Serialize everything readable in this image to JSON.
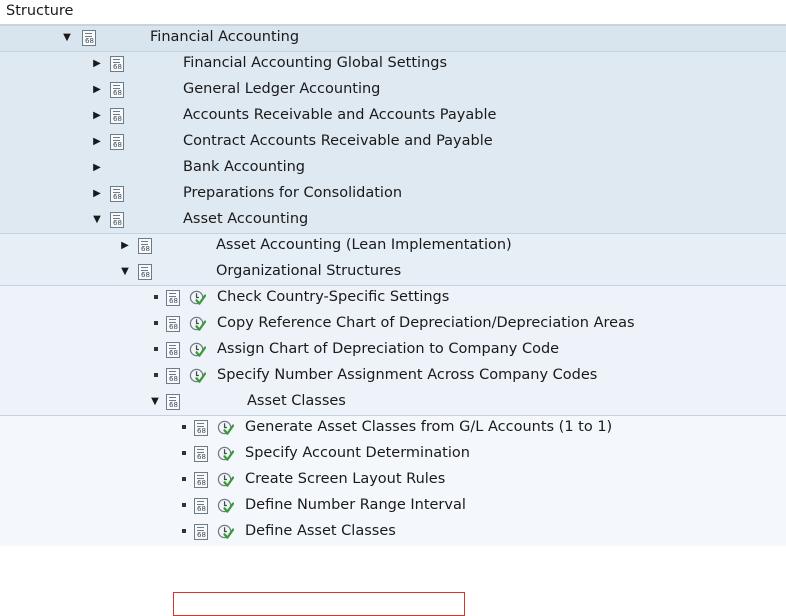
{
  "header": {
    "label": "Structure"
  },
  "rows": [
    {
      "label": "Financial Accounting",
      "toggle": "expanded",
      "icons": [
        "doc-icon"
      ]
    },
    {
      "label": "Financial Accounting Global Settings",
      "toggle": "collapsed",
      "icons": [
        "doc-icon"
      ]
    },
    {
      "label": "General Ledger Accounting",
      "toggle": "collapsed",
      "icons": [
        "doc-icon"
      ]
    },
    {
      "label": "Accounts Receivable and Accounts Payable",
      "toggle": "collapsed",
      "icons": [
        "doc-icon"
      ]
    },
    {
      "label": "Contract Accounts Receivable and Payable",
      "toggle": "collapsed",
      "icons": [
        "doc-icon"
      ]
    },
    {
      "label": "Bank Accounting",
      "toggle": "collapsed",
      "icons": []
    },
    {
      "label": "Preparations for Consolidation",
      "toggle": "collapsed",
      "icons": [
        "doc-icon"
      ]
    },
    {
      "label": "Asset Accounting",
      "toggle": "expanded",
      "icons": [
        "doc-icon"
      ]
    },
    {
      "label": "Asset Accounting (Lean Implementation)",
      "toggle": "collapsed",
      "icons": [
        "doc-icon"
      ]
    },
    {
      "label": "Organizational Structures",
      "toggle": "expanded",
      "icons": [
        "doc-icon"
      ]
    },
    {
      "label": "Check Country-Specific Settings",
      "toggle": "leaf",
      "icons": [
        "doc-icon",
        "execute-icon"
      ]
    },
    {
      "label": "Copy Reference Chart of Depreciation/Depreciation Areas",
      "toggle": "leaf",
      "icons": [
        "doc-icon",
        "execute-icon"
      ]
    },
    {
      "label": "Assign Chart of Depreciation to Company Code",
      "toggle": "leaf",
      "icons": [
        "doc-icon",
        "execute-icon"
      ]
    },
    {
      "label": "Specify Number Assignment Across Company Codes",
      "toggle": "leaf",
      "icons": [
        "doc-icon",
        "execute-icon"
      ]
    },
    {
      "label": "Asset Classes",
      "toggle": "expanded",
      "icons": [
        "doc-icon"
      ]
    },
    {
      "label": "Generate Asset Classes from G/L Accounts (1 to 1)",
      "toggle": "leaf",
      "icons": [
        "doc-icon",
        "execute-icon"
      ]
    },
    {
      "label": "Specify Account Determination",
      "toggle": "leaf",
      "icons": [
        "doc-icon",
        "execute-icon"
      ]
    },
    {
      "label": "Create Screen Layout Rules",
      "toggle": "leaf",
      "icons": [
        "doc-icon",
        "execute-icon"
      ]
    },
    {
      "label": "Define Number Range Interval",
      "toggle": "leaf",
      "icons": [
        "doc-icon",
        "execute-icon"
      ]
    },
    {
      "label": "Define Asset Classes",
      "toggle": "leaf",
      "icons": [
        "doc-icon",
        "execute-icon"
      ],
      "highlighted": true
    }
  ],
  "colors": {
    "level0": "#d8e4ee",
    "level1": "#dfe9f2",
    "level2": "#e6eef6",
    "level3": "#edf3f9",
    "level4": "#f4f8fc",
    "highlight": "#d9342b",
    "execute_green": "#3a9a3a"
  }
}
